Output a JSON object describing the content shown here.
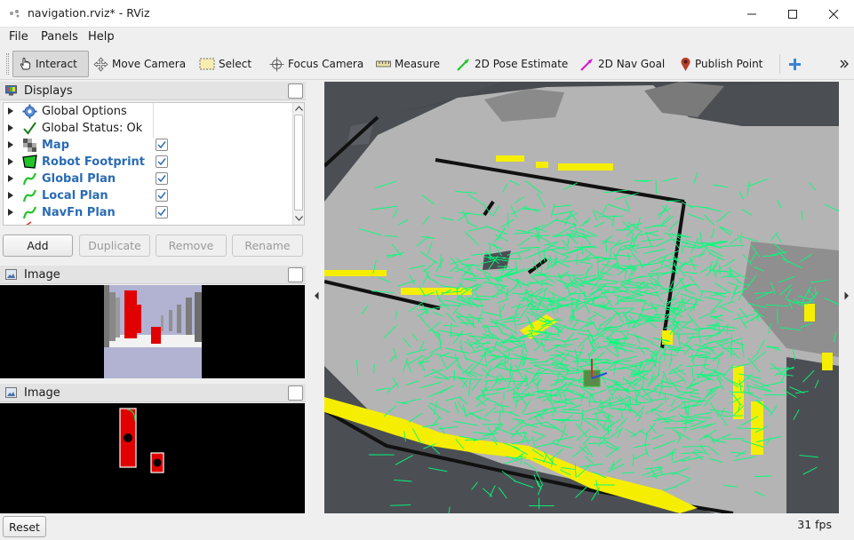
{
  "window": {
    "title": "navigation.rviz* - RViz"
  },
  "menu": {
    "items": [
      "File",
      "Panels",
      "Help"
    ]
  },
  "toolbar": {
    "tools": [
      {
        "label": "Interact",
        "icon": "hand-pointer-icon",
        "active": true
      },
      {
        "label": "Move Camera",
        "icon": "move-camera-icon",
        "active": false
      },
      {
        "label": "Select",
        "icon": "select-icon",
        "active": false
      },
      {
        "label": "Focus Camera",
        "icon": "focus-camera-icon",
        "active": false
      },
      {
        "label": "Measure",
        "icon": "ruler-icon",
        "active": false
      },
      {
        "label": "2D Pose Estimate",
        "icon": "pose-estimate-arrow-icon",
        "active": false
      },
      {
        "label": "2D Nav Goal",
        "icon": "nav-goal-arrow-icon",
        "active": false
      },
      {
        "label": "Publish Point",
        "icon": "map-pin-icon",
        "active": false
      }
    ],
    "add_tool_icon": "plus-icon",
    "overflow_icon": "chevron-double-right-icon"
  },
  "displays_panel": {
    "title": "Displays",
    "items": [
      {
        "label": "Global Options",
        "icon": "gear-icon",
        "enabled": null,
        "highlight": false
      },
      {
        "label": "Global Status: Ok",
        "icon": "checkmark-icon",
        "enabled": null,
        "highlight": false
      },
      {
        "label": "Map",
        "icon": "grid-map-icon",
        "enabled": true,
        "highlight": true
      },
      {
        "label": "Robot Footprint",
        "icon": "polygon-icon",
        "enabled": true,
        "highlight": true
      },
      {
        "label": "Global Plan",
        "icon": "path-icon",
        "enabled": true,
        "highlight": true
      },
      {
        "label": "Local Plan",
        "icon": "path-icon",
        "enabled": true,
        "highlight": true
      },
      {
        "label": "NavFn Plan",
        "icon": "path-icon",
        "enabled": true,
        "highlight": true
      }
    ],
    "buttons": {
      "add": "Add",
      "duplicate": "Duplicate",
      "remove": "Remove",
      "rename": "Rename"
    }
  },
  "image_panel_1": {
    "title": "Image"
  },
  "image_panel_2": {
    "title": "Image"
  },
  "status": {
    "reset_label": "Reset",
    "fps": "31 fps"
  },
  "colors": {
    "map_free": "#b4b4b4",
    "map_unknown": "#474b50",
    "obstacle_yellow": "#f5ee00",
    "particle_green": "#00ff7a",
    "highlight_blue": "#2a6bb4"
  }
}
